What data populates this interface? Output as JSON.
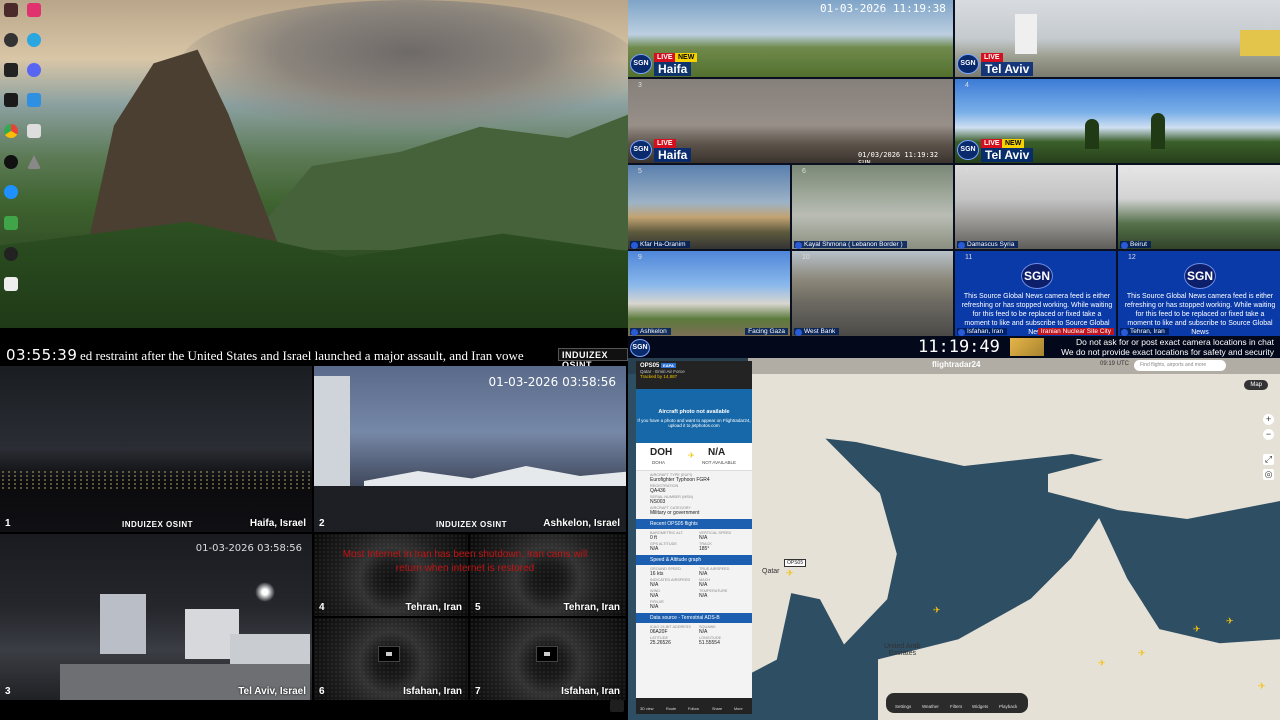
{
  "israel_wall": {
    "clock": "03:55:39",
    "ticker": "ed restraint after the United States and Israel launched a major assault, and Iran vowe",
    "logo": "INDUIZEX OSINT",
    "cams": [
      {
        "num": "1",
        "city": "Haifa, Israel",
        "brand": "INDUIZEX OSINT"
      },
      {
        "num": "2",
        "city": "Ashkelon, Israel",
        "timestamp": "01-03-2026 03:58:56",
        "brand": "INDUIZEX OSINT"
      },
      {
        "num": "3",
        "city": "Tel Aviv, Israel",
        "timestamp": "01-03-2026 03:58:56"
      },
      {
        "num": "4",
        "city": "Tehran, Iran"
      },
      {
        "num": "5",
        "city": "Tehran, Iran"
      },
      {
        "num": "6",
        "city": "Isfahan, Iran"
      },
      {
        "num": "7",
        "city": "Isfahan, Iran"
      }
    ],
    "iran_notice": "Most Internet in Iran has been shutdown. Iran cams will return when internet is restored"
  },
  "sgn_wall": {
    "tiles": [
      {
        "num": "",
        "name": "Haifa",
        "live": "LIVE",
        "new": "NEW",
        "timestamp": "01-03-2026 11:19:38"
      },
      {
        "num": "",
        "name": "Tel Aviv",
        "live": "LIVE"
      },
      {
        "num": "3",
        "name": "Haifa",
        "live": "LIVE",
        "timestamp": "01/03/2026 11:19:32 SUN"
      },
      {
        "num": "4",
        "name": "Tel Aviv",
        "live": "LIVE",
        "new": "NEW"
      },
      {
        "num": "5",
        "name": "Kfar Ha-Oranim"
      },
      {
        "num": "6",
        "name": "Kayal Shmona ( Lebanon Border )"
      },
      {
        "num": "7",
        "name": "Damascus Syria"
      },
      {
        "num": "8",
        "name": "Beirut"
      },
      {
        "num": "9",
        "name": "Ashkelon",
        "extra": "Facing Gaza"
      },
      {
        "num": "10",
        "name": "West Bank"
      },
      {
        "num": "11",
        "name": "Isfahan, Iran",
        "extra": "Iranian Nuclear Site City",
        "logo": "SGN",
        "msg": "This Source Global News camera feed is either refreshing or has stopped working. While waiting for this feed to be replaced or fixed take a moment to like and subscribe to Source Global News"
      },
      {
        "num": "12",
        "name": "Tehran, Iran",
        "logo": "SGN",
        "msg": "This Source Global News camera feed is either refreshing or has stopped working. While waiting for this feed to be replaced or fixed take a moment to like and subscribe to Source Global News"
      }
    ],
    "bar_logo": "SGN",
    "clock": "11:19:49",
    "note_line1": "Do not ask for or post exact camera locations in chat",
    "note_line2": "We do not provide exact locations for safety and security reasons"
  },
  "flightradar": {
    "brand": "flightradar24",
    "time": "09:19 UTC",
    "search_placeholder": "Find flights, airports and more",
    "map_button": "Map",
    "zoom_in": "+",
    "zoom_out": "−",
    "map_labels": {
      "qatar": "Qatar",
      "uae_line1": "United Arab",
      "uae_line2": "Emirates",
      "flight_tag": "OPS05"
    },
    "bottom_nav": [
      "Settings",
      "Weather",
      "Filters",
      "Widgets",
      "Playback"
    ],
    "panel": {
      "callsign": "OPS05",
      "callsign_badge": "EAPA",
      "operator": "Qatar · Emiri Air Force",
      "tracked": "Tracked by 14,887",
      "photo_title": "Aircraft photo not available",
      "photo_hint": "If you have a photo and want to appear on Flightradar24, upload it to jetphotos.com",
      "origin": "DOH",
      "origin_city": "DOHA",
      "destination": "N/A",
      "destination_sub": "NOT AVAILABLE",
      "fields": [
        {
          "label": "Aircraft type (EUFI)",
          "value": "Eurofighter Typhoon FGR4"
        },
        {
          "label": "Registration",
          "value": "QA436"
        },
        {
          "label": "Serial number (MSN)",
          "value": "NS003"
        },
        {
          "label": "Aircraft category",
          "value": "Military or government"
        }
      ],
      "sec_recent": "Recent OPS05 flights",
      "grid1": [
        {
          "label": "Barometric alt.",
          "value": "0 ft"
        },
        {
          "label": "Vertical speed",
          "value": "N/A"
        },
        {
          "label": "GPS altitude",
          "value": "N/A"
        },
        {
          "label": "Track",
          "value": "185°"
        }
      ],
      "sec_speed": "Speed & Altitude graph",
      "grid2": [
        {
          "label": "Ground speed",
          "value": "16 kts"
        },
        {
          "label": "True airspeed",
          "value": "N/A"
        },
        {
          "label": "Indicated airspeed",
          "value": "N/A"
        },
        {
          "label": "Mach",
          "value": "N/A"
        },
        {
          "label": "Wind",
          "value": "N/A"
        },
        {
          "label": "Temperature",
          "value": "N/A"
        },
        {
          "label": "FIR/UIR",
          "value": "N/A"
        }
      ],
      "sec_source": "Data source - Terrestrial ADS-B",
      "grid3": [
        {
          "label": "ICAO 24-bit address",
          "value": "06A20F"
        },
        {
          "label": "Squawk",
          "value": "N/A"
        },
        {
          "label": "Latitude",
          "value": "25.26526"
        },
        {
          "label": "Longitude",
          "value": "51.55554"
        }
      ],
      "footer": [
        "3D view",
        "Route",
        "Follow",
        "Share",
        "More"
      ]
    }
  }
}
